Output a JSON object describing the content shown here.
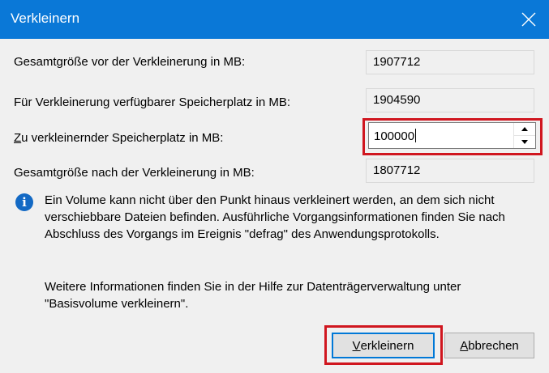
{
  "window": {
    "title": "Verkleinern"
  },
  "rows": {
    "total_before": {
      "label": "Gesamtgröße vor der Verkleinerung in MB:",
      "value": "1907712"
    },
    "available": {
      "label": "Für Verkleinerung verfügbarer Speicherplatz in MB:",
      "value": "1904590"
    },
    "shrink_amount": {
      "label_accel": "Z",
      "label_rest": "u verkleinernder Speicherplatz in MB:",
      "value": "100000"
    },
    "total_after": {
      "label": "Gesamtgröße nach der Verkleinerung in MB:",
      "value": "1807712"
    }
  },
  "info": {
    "icon": "info-icon",
    "lines": [
      "Ein Volume kann nicht über den Punkt hinaus verkleinert werden, an dem sich nicht",
      "verschiebbare Dateien befinden. Ausführliche Vorgangsinformationen finden Sie nach",
      "Abschluss des Vorgangs im Ereignis \"defrag\" des Anwendungsprotokolls."
    ],
    "help_lines": [
      "Weitere Informationen finden Sie in der Hilfe zur Datenträgerverwaltung unter",
      "\"Basisvolume verkleinern\"."
    ]
  },
  "buttons": {
    "ok_accel": "V",
    "ok_rest": "erkleinern",
    "cancel_accel": "A",
    "cancel_rest": "bbrechen"
  },
  "colors": {
    "titlebar": "#0a78d7",
    "highlight": "#d0161f",
    "info": "#1369c4"
  }
}
